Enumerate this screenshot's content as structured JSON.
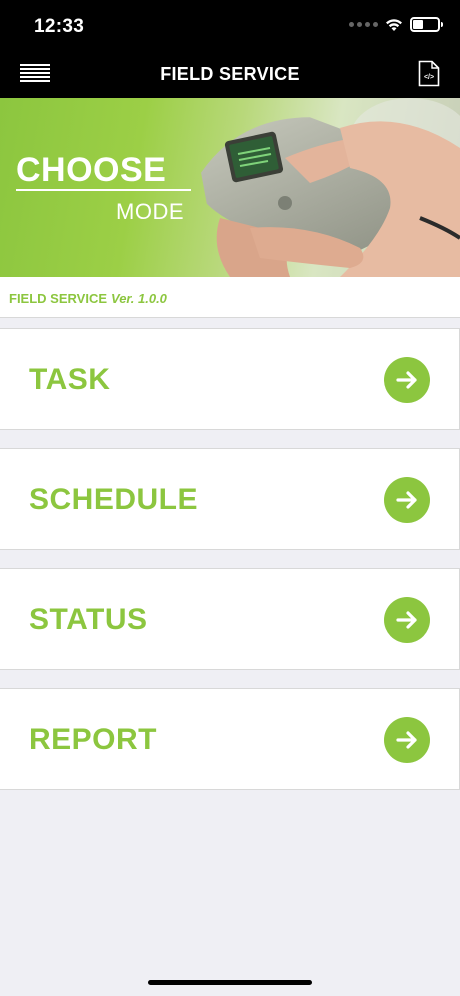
{
  "status_bar": {
    "time": "12:33"
  },
  "nav": {
    "title": "FIELD SERVICE",
    "menu_icon": "hamburger-menu-icon",
    "doc_icon": "code-document-icon"
  },
  "hero": {
    "title_line1": "CHOOSE",
    "title_line2": "MODE"
  },
  "version": {
    "app_name": "FIELD SERVICE",
    "version": "Ver. 1.0.0"
  },
  "modes": [
    {
      "label": "TASK"
    },
    {
      "label": "SCHEDULE"
    },
    {
      "label": "STATUS"
    },
    {
      "label": "REPORT"
    }
  ],
  "colors": {
    "accent": "#8cc63f",
    "bar": "#000000",
    "background": "#efeff4"
  }
}
